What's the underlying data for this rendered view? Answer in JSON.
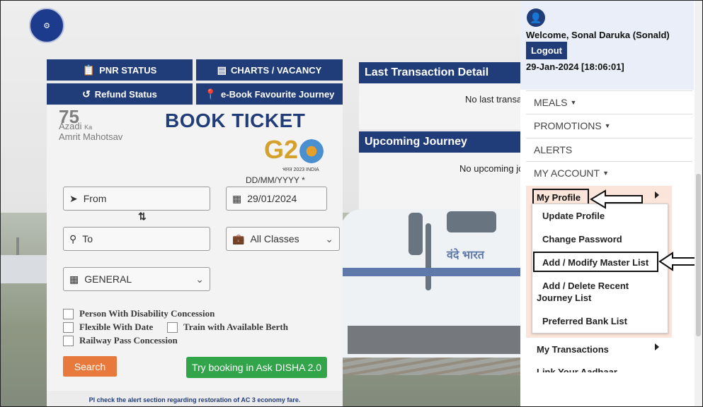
{
  "nav": {
    "pnr_status": "PNR STATUS",
    "charts_vacancy": "CHARTS / VACANCY",
    "refund_status": "Refund Status",
    "ebook_favourite": "e-Book Favourite Journey"
  },
  "booking": {
    "title": "BOOK TICKET",
    "azadi_70": "75",
    "azadi_line1": "Azadi",
    "azadi_ka": "Ka",
    "azadi_line2": "Amrit Mahotsav",
    "g20_text": "G2",
    "g20_caption": "भारत 2023 INDIA",
    "date_format": "DD/MM/YYYY *",
    "from_placeholder": "From",
    "date_value": "29/01/2024",
    "to_placeholder": "To",
    "class_value": "All Classes",
    "quota_value": "GENERAL",
    "options": {
      "disability": "Person With Disability Concession",
      "flexible": "Flexible With Date",
      "available_berth": "Train with Available Berth",
      "railway_pass": "Railway Pass Concession"
    },
    "search_label": "Search",
    "disha_label": "Try booking in Ask DISHA 2.0",
    "alert_text": "Pl check the alert section regarding restoration of AC 3 economy fare."
  },
  "transactions": {
    "last_title": "Last Transaction Detail",
    "last_body": "No last transaction",
    "upcoming_title": "Upcoming Journey",
    "upcoming_body": "No upcoming journey"
  },
  "train": {
    "logo_text": "वंदे भारत"
  },
  "user": {
    "welcome": "Welcome, Sonal Daruka (Sonald)",
    "logout_label": "Logout",
    "datetime": "29-Jan-2024 [18:06:01]"
  },
  "menu": {
    "meals": "MEALS",
    "promotions": "PROMOTIONS",
    "alerts": "ALERTS",
    "my_account": "MY ACCOUNT",
    "my_profile": "My Profile",
    "profile_items": {
      "update_profile": "Update Profile",
      "change_password": "Change Password",
      "master_list": "Add / Modify Master List",
      "recent_journey_1": "Add / Delete Recent",
      "recent_journey_2": "Journey List",
      "bank_list": "Preferred Bank List"
    },
    "my_transactions": "My Transactions",
    "link_aadhaar": "Link Your Aadhaar"
  }
}
